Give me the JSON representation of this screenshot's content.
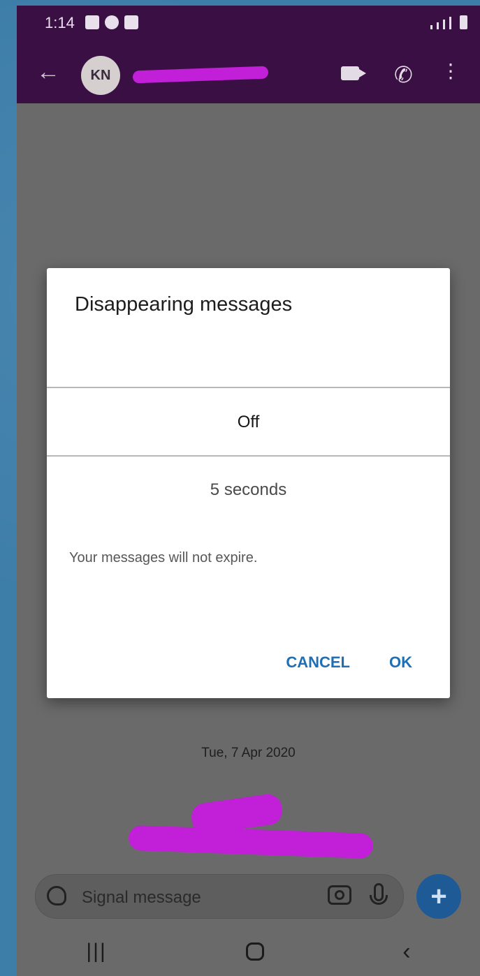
{
  "status_bar": {
    "time": "1:14"
  },
  "app_bar": {
    "avatar_initials": "KN"
  },
  "dialog": {
    "title": "Disappearing messages",
    "selected_option": "Off",
    "next_option": "5 seconds",
    "description": "Your messages will not expire.",
    "cancel_label": "CANCEL",
    "ok_label": "OK"
  },
  "conversation": {
    "date_label": "Tue, 7 Apr 2020"
  },
  "composer": {
    "placeholder": "Signal message"
  },
  "icons": {
    "back": "arrow-left",
    "video": "video-camera",
    "call": "phone",
    "menu": "more-vertical",
    "sticker": "sticker",
    "camera": "camera",
    "mic": "microphone",
    "add": "plus"
  },
  "colors": {
    "app_bar": "#3a0f44",
    "accent": "#1e6fb5",
    "fab": "#1d5a96"
  }
}
